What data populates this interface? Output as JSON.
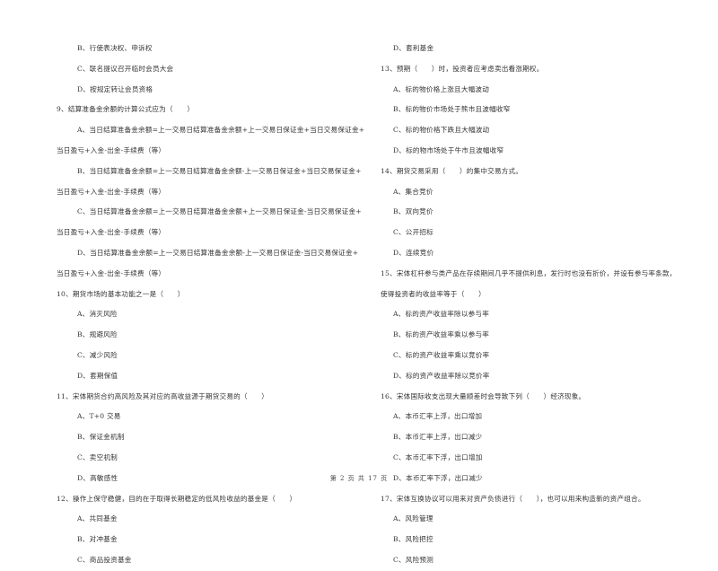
{
  "left_column": [
    {
      "type": "opt",
      "text": "B、行使表决权、申诉权"
    },
    {
      "type": "opt",
      "text": "C、联名提议召开临时会员大会"
    },
    {
      "type": "opt",
      "text": "D、按规定转让会员资格"
    },
    {
      "type": "q",
      "text": "9、结算准备金余额的计算公式应为（　　）"
    },
    {
      "type": "opt",
      "text": "A、当日结算准备金余额=上一交易日结算准备金余额+上一交易日保证金+当日交易保证金+"
    },
    {
      "type": "cont",
      "text": "当日盈亏+入金-出金-手续费（等）"
    },
    {
      "type": "opt",
      "text": "B、当日结算准备金余额=上一交易日结算准备金余额-上一交易日保证金+当日交易保证金+"
    },
    {
      "type": "cont",
      "text": "当日盈亏+入金-出金-手续费（等）"
    },
    {
      "type": "opt",
      "text": "C、当日结算准备金余额=上一交易日结算准备金余额+上一交易日保证金-当日交易保证金+"
    },
    {
      "type": "cont",
      "text": "当日盈亏+入金-出金-手续费（等）"
    },
    {
      "type": "opt",
      "text": "D、当日结算准备金余额=上一交易日结算准备金余额-上一交易日保证金-当日交易保证金+"
    },
    {
      "type": "cont",
      "text": "当日盈亏+入金-出金-手续费（等）"
    },
    {
      "type": "q",
      "text": "10、期货市场的基本功能之一是（　　）"
    },
    {
      "type": "opt",
      "text": "A、消灭风险"
    },
    {
      "type": "opt",
      "text": "B、规避风险"
    },
    {
      "type": "opt",
      "text": "C、减少风险"
    },
    {
      "type": "opt",
      "text": "D、套期保值"
    },
    {
      "type": "q",
      "text": "11、宋体期货合约高风险及其对应的高收益源于期货交易的（　　）"
    },
    {
      "type": "opt",
      "text": "A、T+0 交易"
    },
    {
      "type": "opt",
      "text": "B、保证金机制"
    },
    {
      "type": "opt",
      "text": "C、卖空机制"
    },
    {
      "type": "opt",
      "text": "D、高敏感性"
    },
    {
      "type": "q",
      "text": "12、操作上保守稳健，目的在于取得长期稳定的低风险收益的基金是（　　）"
    },
    {
      "type": "opt",
      "text": "A、共同基金"
    },
    {
      "type": "opt",
      "text": "B、对冲基金"
    },
    {
      "type": "opt",
      "text": "C、商品投资基金"
    }
  ],
  "right_column": [
    {
      "type": "opt",
      "text": "D、套利基金"
    },
    {
      "type": "q",
      "text": "13、预期（　　）时，投资者应考虑卖出看涨期权。"
    },
    {
      "type": "opt",
      "text": "A、标的物价格上涨且大幅波动"
    },
    {
      "type": "opt",
      "text": "B、标的物价市场处于熊市且波幅收窄"
    },
    {
      "type": "opt",
      "text": "C、标的物价格下跌且大幅波动"
    },
    {
      "type": "opt",
      "text": "D、标的物市场处于牛市且波幅收窄"
    },
    {
      "type": "q",
      "text": "14、期货交易采用（　　）的集中交易方式。"
    },
    {
      "type": "opt",
      "text": "A、集合竞价"
    },
    {
      "type": "opt",
      "text": "B、双向竞价"
    },
    {
      "type": "opt",
      "text": "C、公开招标"
    },
    {
      "type": "opt",
      "text": "D、连续竞价"
    },
    {
      "type": "q",
      "text": "15、宋体杠杆参与类产品在存续期间几乎不提供利息，发行时也没有折价，并设有参与率条款，"
    },
    {
      "type": "cont",
      "text": "使得投资者的收益率等于（　　）"
    },
    {
      "type": "opt",
      "text": "A、标的资产收益率除以参与率"
    },
    {
      "type": "opt",
      "text": "B、标的资产收益率乘以参与率"
    },
    {
      "type": "opt",
      "text": "C、标的资产收益率乘以竞价率"
    },
    {
      "type": "opt",
      "text": "D、标的资产收益率除以竞价率"
    },
    {
      "type": "q",
      "text": "16、宋体国际收支出现大量顺差时会导致下列（　　）经济现象。"
    },
    {
      "type": "opt",
      "text": "A、本币汇率上浮，出口增加"
    },
    {
      "type": "opt",
      "text": "B、本币汇率上浮，出口减少"
    },
    {
      "type": "opt",
      "text": "C、本币汇率下浮，出口增加"
    },
    {
      "type": "opt",
      "text": "D、本币汇率下浮，出口减少"
    },
    {
      "type": "q",
      "text": "17、宋体互换协议可以用来对资产负债进行（　　），也可以用来构造新的资产组合。"
    },
    {
      "type": "opt",
      "text": "A、风险管理"
    },
    {
      "type": "opt",
      "text": "B、风险把控"
    },
    {
      "type": "opt",
      "text": "C、风险预测"
    }
  ],
  "footer": {
    "page_label": "第 2 页 共 17 页"
  }
}
